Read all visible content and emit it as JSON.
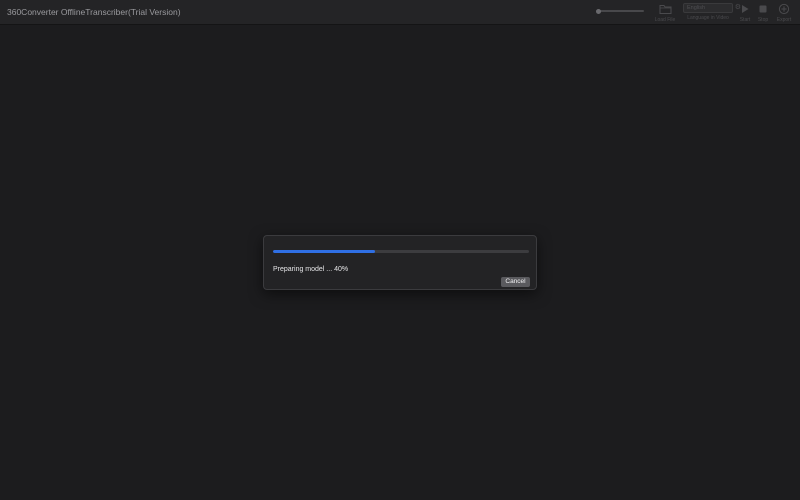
{
  "window": {
    "title": "360Converter OfflineTranscriber(Trial Version)"
  },
  "toolbar": {
    "zoom_slider_value": 0.05,
    "open_file_label": "Load File",
    "language_value": "English",
    "language_label": "Language in Video",
    "start_label": "Start",
    "stop_label": "Stop",
    "export_label": "Export"
  },
  "dialog": {
    "progress_percent": 40,
    "status_text": "Preparing model ... 40%",
    "cancel_label": "Cancel"
  },
  "colors": {
    "background": "#1c1c1e",
    "accent": "#2f6fe4",
    "dialog_bg": "#232325"
  }
}
